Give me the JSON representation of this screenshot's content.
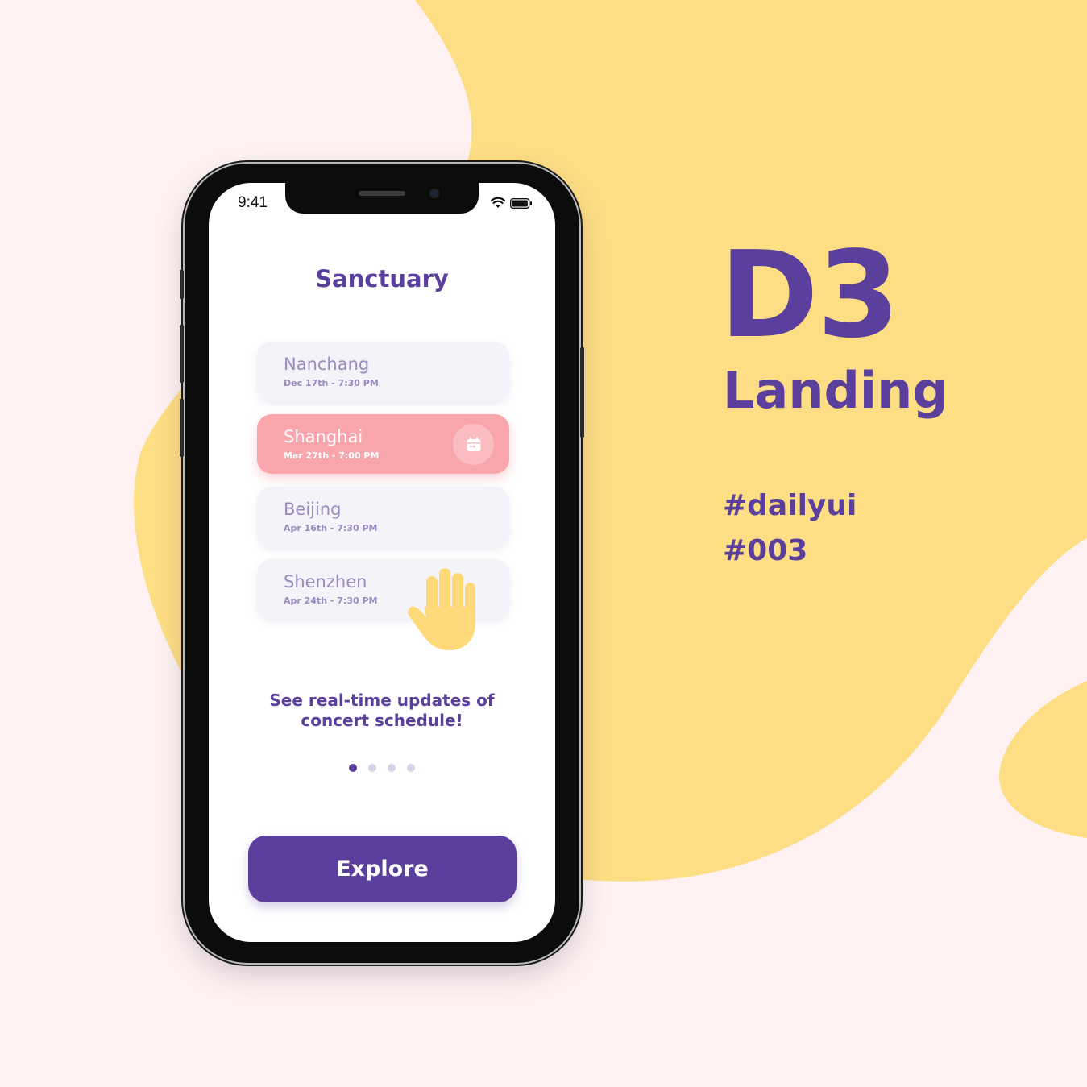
{
  "colors": {
    "background": "#fdf2f1",
    "blob": "#fede84",
    "accent": "#5b3f9c",
    "active_card": "#f9a5ac",
    "card": "#f4f3f9"
  },
  "headline": {
    "code": "D3",
    "title": "Landing",
    "tags": [
      "#dailyui",
      "#003"
    ]
  },
  "status_bar": {
    "time": "9:41",
    "icons": [
      "wifi-icon",
      "battery-icon"
    ]
  },
  "app": {
    "title": "Sanctuary",
    "concerts": [
      {
        "city": "Nanchang",
        "date": "Dec 17th - 7:30 PM",
        "active": false
      },
      {
        "city": "Shanghai",
        "date": "Mar 27th - 7:00 PM",
        "active": true,
        "icon": "calendar-icon"
      },
      {
        "city": "Beijing",
        "date": "Apr 16th - 7:30 PM",
        "active": false
      },
      {
        "city": "Shenzhen",
        "date": "Apr 24th - 7:30 PM",
        "active": false
      }
    ],
    "tagline_line1": "See real-time updates of",
    "tagline_line2": "concert schedule!",
    "pagination": {
      "count": 4,
      "current": 1
    },
    "explore_label": "Explore",
    "hand_icon": "raised-hand-icon"
  }
}
